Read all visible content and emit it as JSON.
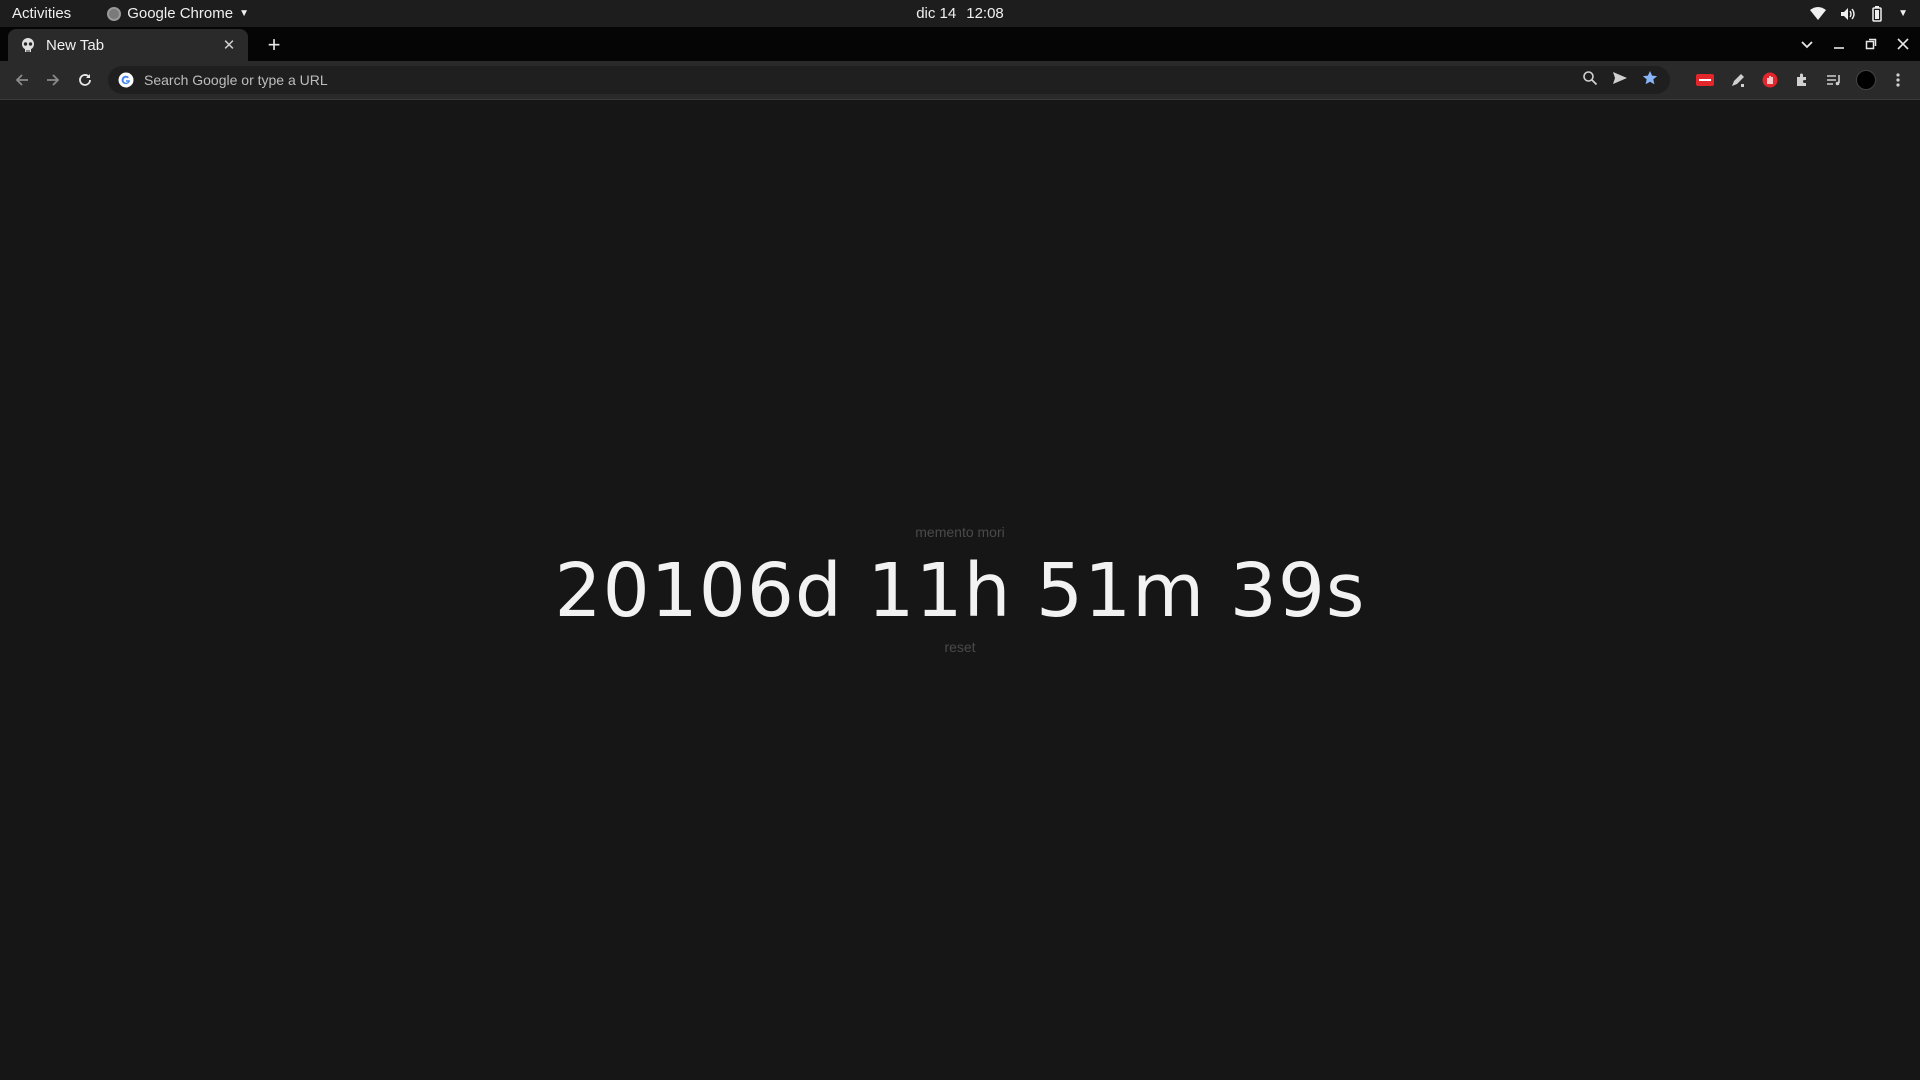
{
  "topbar": {
    "activities": "Activities",
    "app_name": "Google Chrome",
    "date": "dic 14",
    "time": "12:08"
  },
  "tabs": [
    {
      "title": "New Tab",
      "icon": "skull-icon"
    }
  ],
  "omnibox": {
    "placeholder": "Search Google or type a URL",
    "value": ""
  },
  "content": {
    "caption": "memento mori",
    "countdown": "20106d 11h 51m 39s",
    "reset_label": "reset"
  },
  "colors": {
    "background": "#161616",
    "bookmark_star": "#8ab4f8",
    "extension_red": "#e3262b"
  }
}
